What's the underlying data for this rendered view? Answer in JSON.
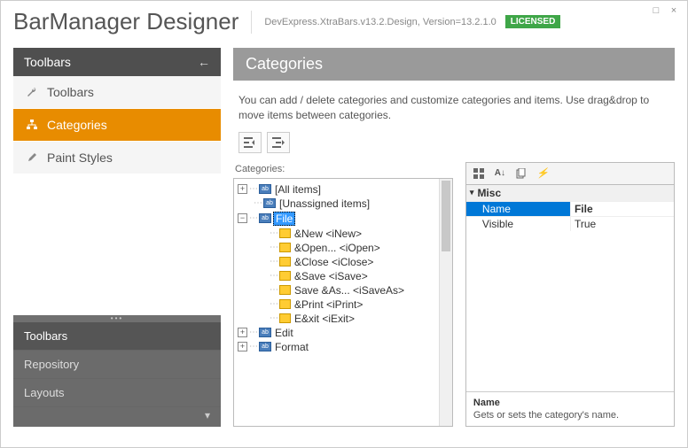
{
  "app": {
    "title": "BarManager Designer",
    "version": "DevExpress.XtraBars.v13.2.Design, Version=13.2.1.0",
    "license": "LICENSED"
  },
  "win": {
    "min": "□",
    "close": "×"
  },
  "sidebar": {
    "header": "Toolbars",
    "items": [
      {
        "label": "Toolbars"
      },
      {
        "label": "Categories"
      },
      {
        "label": "Paint Styles"
      }
    ],
    "sections": [
      {
        "label": "Toolbars"
      },
      {
        "label": "Repository"
      },
      {
        "label": "Layouts"
      }
    ]
  },
  "main": {
    "header": "Categories",
    "desc": "You can add / delete categories and customize categories and items. Use drag&drop to move items between categories.",
    "tree_label": "Categories:",
    "tree": {
      "all": "[All items]",
      "unassigned": "[Unassigned items]",
      "file": "File",
      "file_items": [
        "&New  <iNew>",
        "&Open...  <iOpen>",
        "&Close  <iClose>",
        "&Save  <iSave>",
        "Save &As...  <iSaveAs>",
        "&Print  <iPrint>",
        "E&xit  <iExit>"
      ],
      "edit": "Edit",
      "format": "Format"
    },
    "props": {
      "group": "Misc",
      "rows": [
        {
          "name": "Name",
          "value": "File",
          "sel": true
        },
        {
          "name": "Visible",
          "value": "True",
          "sel": false
        }
      ],
      "help_title": "Name",
      "help_text": "Gets or sets the category's name."
    }
  }
}
